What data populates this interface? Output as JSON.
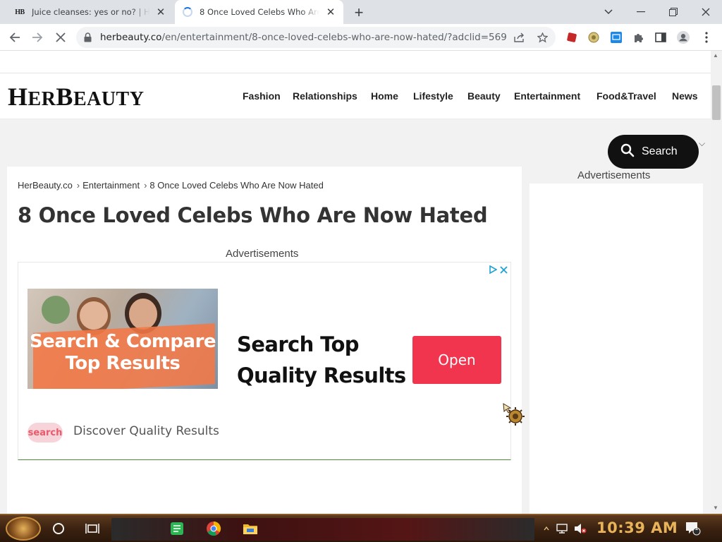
{
  "browser": {
    "tabs": [
      {
        "title": "Juice cleanses: yes or no? | Her",
        "favicon": "HB",
        "state": "inactive"
      },
      {
        "title": "8 Once Loved Celebs Who Are Now",
        "favicon": "loading-spinner",
        "state": "active"
      }
    ],
    "new_tab": "+",
    "url_host": "herbeauty.co",
    "url_rest": "/en/entertainment/8-once-loved-celebs-who-are-now-hated/?adclid=569..."
  },
  "site": {
    "logo_first": "H",
    "logo_rest1": "ER",
    "logo_b": "B",
    "logo_rest2": "EAUTY",
    "nav": [
      "Fashion",
      "Relationships",
      "Home",
      "Lifestyle",
      "Beauty",
      "Entertainment",
      "Food&Travel",
      "News"
    ],
    "search_label": "Search"
  },
  "article": {
    "breadcrumb": [
      "HerBeauty.co",
      "Entertainment",
      "8 Once Loved Celebs Who Are Now Hated"
    ],
    "breadcrumb_sep": "›",
    "headline": "8 Once Loved Celebs Who Are Now Hated",
    "ads_label": "Advertisements"
  },
  "ad": {
    "image_text_line1": "Search & Compare",
    "image_text_line2": "Top Results",
    "headline_line1": "Search Top",
    "headline_line2": "Quality Results",
    "cta": "Open",
    "logo_text": "search",
    "tagline": "Discover Quality Results",
    "cta_color": "#f2354f"
  },
  "sidebar": {
    "ads_label": "Advertisements"
  },
  "taskbar": {
    "clock": "10:39 AM",
    "notification_count": "1"
  },
  "colors": {
    "accent": "#1a73e8",
    "search_button_bg": "#111111",
    "taskbar_clock": "#e9b35a"
  }
}
